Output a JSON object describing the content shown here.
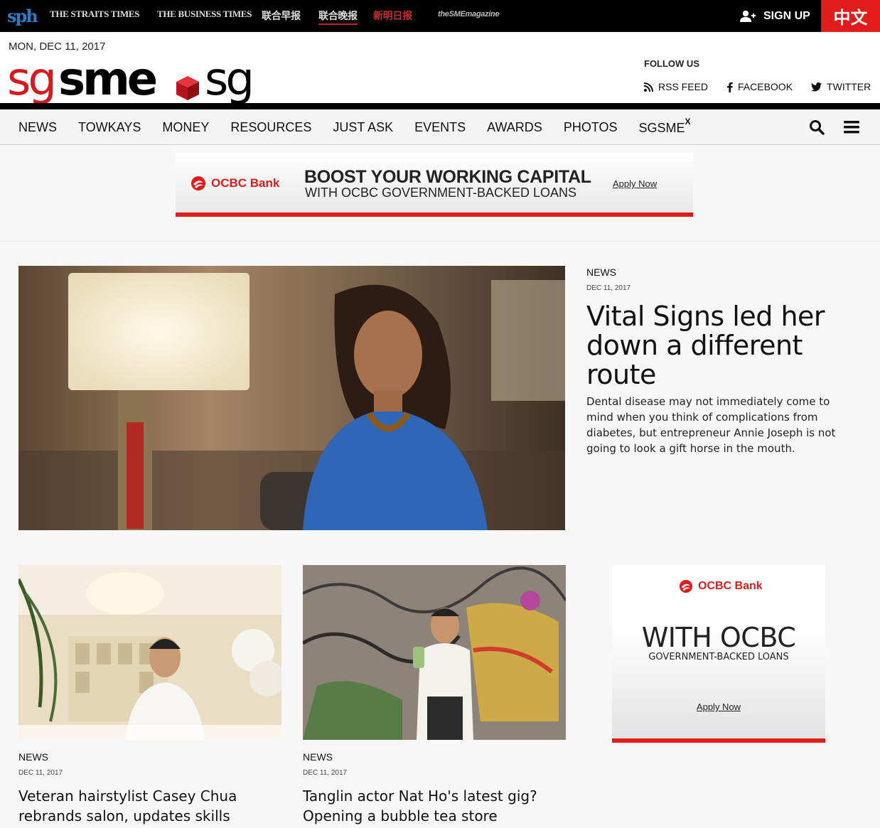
{
  "topbar": {
    "publications": [
      "THE STRAITS TIMES",
      "THE BUSINESS TIMES",
      "联合早报",
      "联合晚报",
      "新明日报",
      "theSMEmagazine"
    ],
    "signup": "SIGN UP",
    "lang": "中文",
    "sph": "sph"
  },
  "header": {
    "date": "MON, DEC 11, 2017",
    "logo_text": "sgsme.sg",
    "follow_title": "FOLLOW US",
    "rss": "RSS FEED",
    "facebook": "FACEBOOK",
    "twitter": "TWITTER"
  },
  "nav": {
    "items": [
      "NEWS",
      "TOWKAYS",
      "MONEY",
      "RESOURCES",
      "JUST ASK",
      "EVENTS",
      "AWARDS",
      "PHOTOS",
      "SGSME"
    ],
    "sgsme_sup": "X"
  },
  "banner_ad": {
    "bank": "OCBC Bank",
    "headline": "BOOST YOUR WORKING CAPITAL",
    "sub": "WITH OCBC GOVERNMENT-BACKED LOANS",
    "cta": "Apply Now"
  },
  "feature": {
    "category": "NEWS",
    "date": "DEC 11, 2017",
    "title": "Vital Signs led her down a different route",
    "description": "Dental disease may not immediately come to mind when you think of complications from diabetes, but entrepreneur Annie Joseph is not going to look a gift horse in the mouth."
  },
  "cards": [
    {
      "category": "NEWS",
      "date": "DEC 11, 2017",
      "title": "Veteran hairstylist Casey Chua rebrands salon, updates skills"
    },
    {
      "category": "NEWS",
      "date": "DEC 11, 2017",
      "title": "Tanglin actor Nat Ho's latest gig? Opening a bubble tea store"
    }
  ],
  "side_ad": {
    "bank": "OCBC Bank",
    "headline": "WITH OCBC",
    "sub": "GOVERNMENT-BACKED LOANS",
    "cta": "Apply Now"
  },
  "colors": {
    "brand_red": "#e21b1b",
    "black": "#000000"
  }
}
